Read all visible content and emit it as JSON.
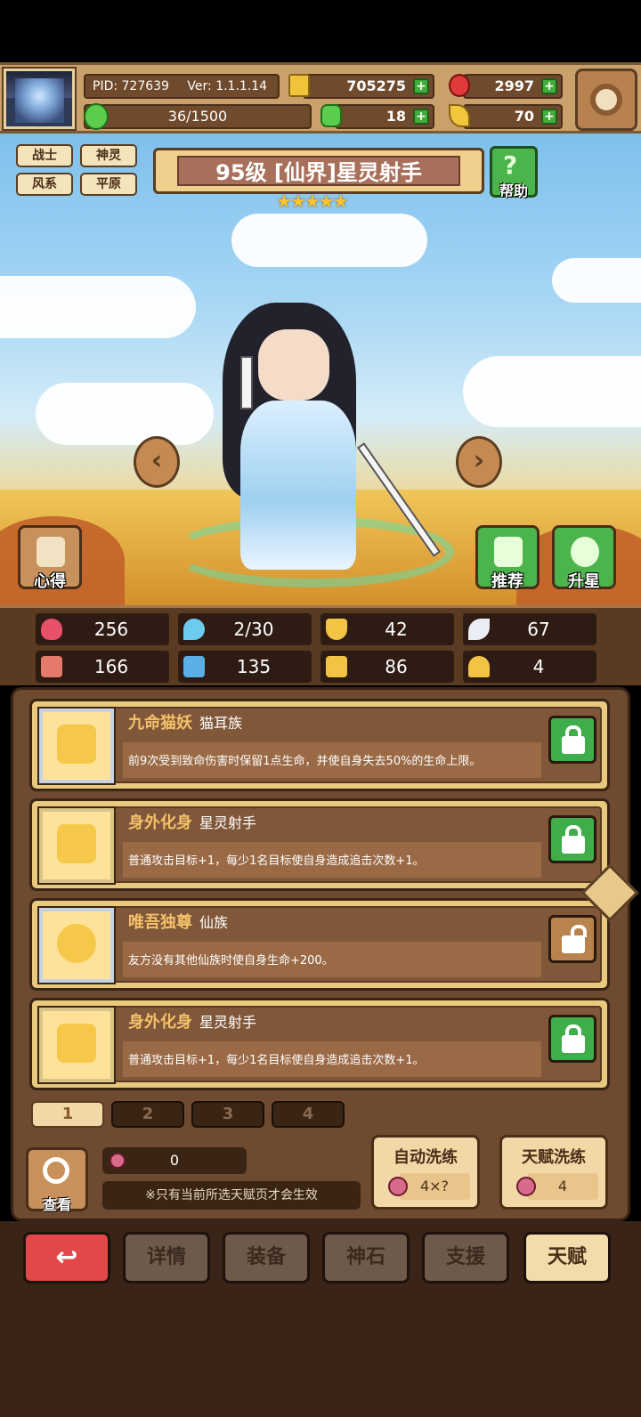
{
  "header": {
    "pid_label": "PID: 727639",
    "version_label": "Ver: 1.1.1.14",
    "gold": "705275",
    "gems": "2997",
    "stamina": "36/1500",
    "clover": "18",
    "feather": "70"
  },
  "tags": [
    "战士",
    "神灵",
    "风系",
    "平原"
  ],
  "hero": {
    "title": "95级 [仙界]星灵射手",
    "stars": "★★★★★",
    "help_label": "帮助"
  },
  "scene": {
    "left_button_label": "心得",
    "recommend_label": "推荐",
    "starup_label": "升星",
    "prev_arrow": "‹",
    "next_arrow": "›"
  },
  "stats": [
    {
      "icon": "heart-icon",
      "value": "256",
      "color": "#e8506a"
    },
    {
      "icon": "water-drop-icon",
      "value": "2/30",
      "color": "#6ecbf0"
    },
    {
      "icon": "shield-icon",
      "value": "42",
      "color": "#f2c444"
    },
    {
      "icon": "wing-icon",
      "value": "67",
      "color": "#e9eef4"
    },
    {
      "icon": "fist-icon",
      "value": "166",
      "color": "#e67a6a"
    },
    {
      "icon": "book-icon",
      "value": "135",
      "color": "#5ab0e6"
    },
    {
      "icon": "boot-icon",
      "value": "86",
      "color": "#f2c444"
    },
    {
      "icon": "horseshoe-icon",
      "value": "4",
      "color": "#f2c444"
    }
  ],
  "talents": [
    {
      "name": "九命猫妖",
      "race": "猫耳族",
      "desc": "前9次受到致命伤害时保留1点生命，并使自身失去50%的生命上限。",
      "lock": "green"
    },
    {
      "name": "身外化身",
      "race": "星灵射手",
      "desc": "普通攻击目标+1，每少1名目标使自身造成追击次数+1。",
      "lock": "green"
    },
    {
      "name": "唯吾独尊",
      "race": "仙族",
      "desc": "友方没有其他仙族时使自身生命+200。",
      "lock": "brown"
    },
    {
      "name": "身外化身",
      "race": "星灵射手",
      "desc": "普通攻击目标+1，每少1名目标使自身造成追击次数+1。",
      "lock": "green"
    }
  ],
  "pages": [
    "1",
    "2",
    "3",
    "4"
  ],
  "bottom_panel": {
    "view_label": "查看",
    "token_count": "0",
    "note": "※只有当前所选天赋页才会生效",
    "auto_wash_label": "自动洗练",
    "auto_wash_value": "4×?",
    "talent_wash_label": "天赋洗练",
    "talent_wash_value": "4"
  },
  "nav": {
    "back": "↩",
    "details": "详情",
    "equipment": "装备",
    "godstone": "神石",
    "support": "支援",
    "talent": "天赋"
  }
}
